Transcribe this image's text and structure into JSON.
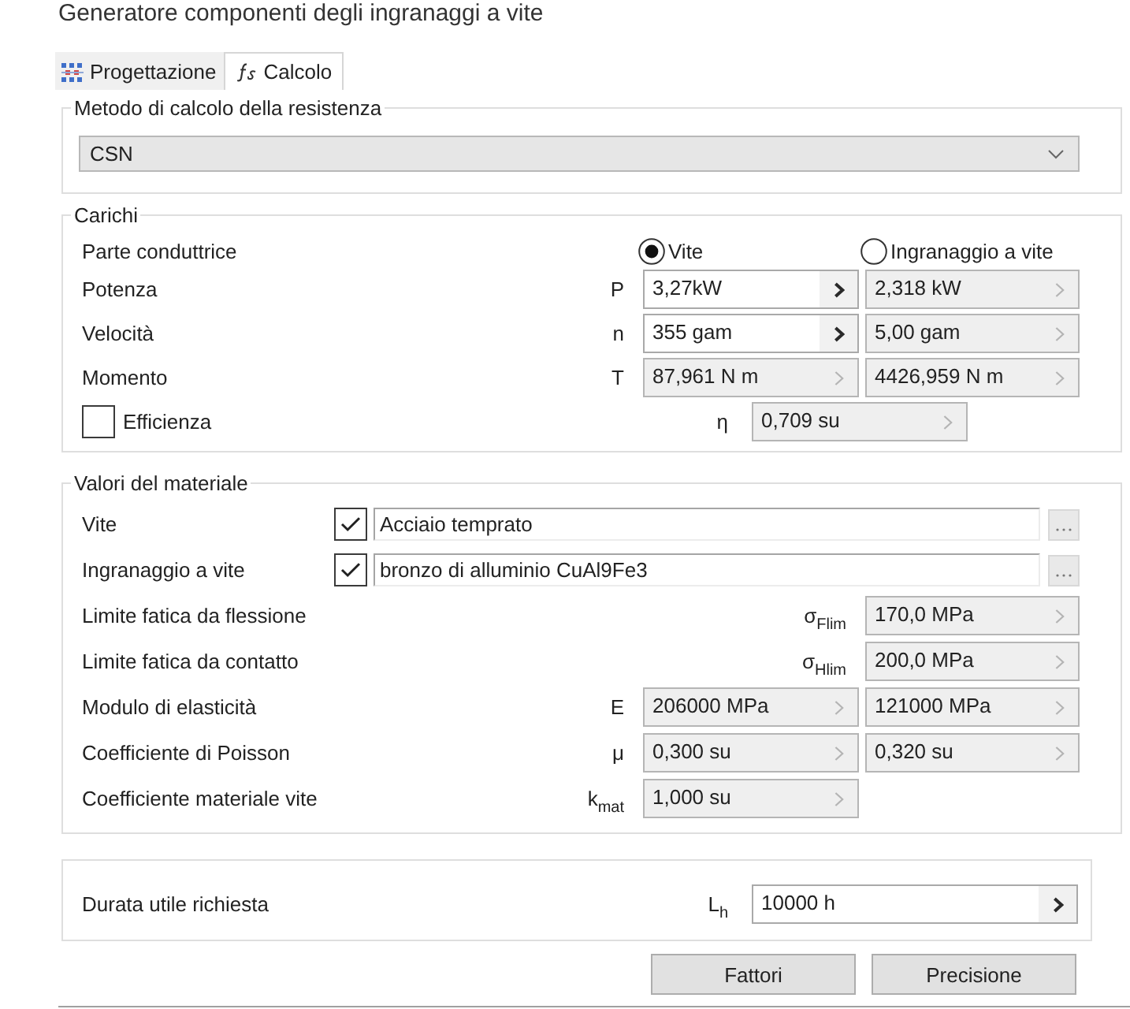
{
  "window": {
    "title": "Generatore componenti degli ingranaggi a vite"
  },
  "tabs": [
    {
      "label": "Progettazione",
      "selected": false
    },
    {
      "label": "Calcolo",
      "selected": true
    }
  ],
  "strength_method": {
    "title": "Metodo di calcolo della resistenza",
    "dropdown": {
      "value": "CSN"
    }
  },
  "loads": {
    "title": "Carichi",
    "driving_part": {
      "label": "Parte conduttrice",
      "options": [
        {
          "label": "Vite",
          "selected": true
        },
        {
          "label": "Ingranaggio a vite",
          "selected": false
        }
      ]
    },
    "rows": [
      {
        "label": "Potenza",
        "symbol": "P",
        "worm": {
          "value": "3,27kW",
          "disabled": false
        },
        "wheel": {
          "value": "2,318 kW",
          "disabled": true
        }
      },
      {
        "label": "Velocità",
        "symbol": "n",
        "worm": {
          "value": "355 gam",
          "disabled": false
        },
        "wheel": {
          "value": "5,00 gam",
          "disabled": true
        }
      },
      {
        "label": "Momento",
        "symbol": "T",
        "worm": {
          "value": "87,961 N m",
          "disabled": true
        },
        "wheel": {
          "value": "4426,959 N m",
          "disabled": true
        }
      }
    ],
    "efficiency": {
      "label": "Efficienza",
      "checked": false,
      "symbol": "η",
      "field": {
        "value": "0,709 su",
        "disabled": true
      }
    }
  },
  "material": {
    "title": "Valori del materiale",
    "materials": [
      {
        "label": "Vite",
        "checked": true,
        "value": "Acciaio temprato"
      },
      {
        "label": "Ingranaggio a vite",
        "checked": true,
        "value": "bronzo di alluminio CuAl9Fe3"
      }
    ],
    "rows": [
      {
        "label": "Limite fatica da flessione",
        "symbol": "σ$_{Flim}$",
        "wheel": {
          "value": "170,0 MPa",
          "disabled": true
        }
      },
      {
        "label": "Limite fatica da contatto",
        "symbol": "σ$_{Hlim}$",
        "wheel": {
          "value": "200,0 MPa",
          "disabled": true
        }
      },
      {
        "label": "Modulo di elasticità",
        "symbol": "E",
        "worm": {
          "value": "206000 MPa",
          "disabled": true
        },
        "wheel": {
          "value": "121000 MPa",
          "disabled": true
        }
      },
      {
        "label": "Coefficiente di Poisson",
        "symbol": "μ",
        "worm": {
          "value": "0,300 su",
          "disabled": true
        },
        "wheel": {
          "value": "0,320 su",
          "disabled": true
        }
      },
      {
        "label": "Coefficiente materiale vite",
        "symbol": "k$_{mat}$",
        "worm": {
          "value": "1,000 su",
          "disabled": true
        }
      }
    ]
  },
  "service_life": {
    "label": "Durata utile richiesta",
    "symbol": "L$_{h}$",
    "field": {
      "value": "10000 h",
      "disabled": false
    }
  },
  "buttons": [
    {
      "label": "Fattori"
    },
    {
      "label": "Precisione"
    }
  ]
}
